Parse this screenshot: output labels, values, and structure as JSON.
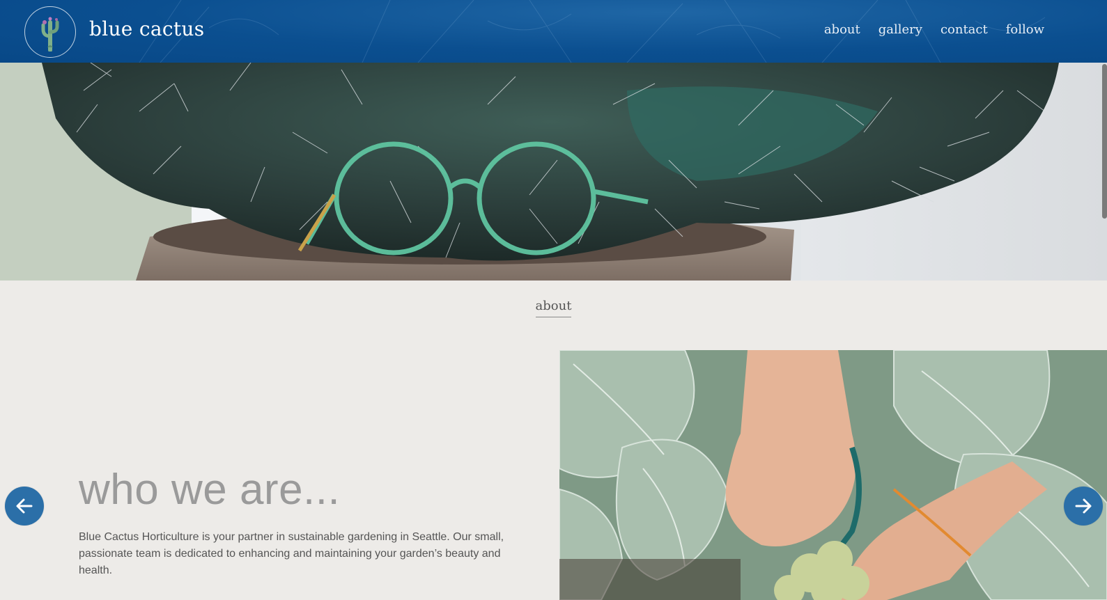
{
  "header": {
    "brand": "blue cactus",
    "nav": [
      {
        "label": "about"
      },
      {
        "label": "gallery"
      },
      {
        "label": "contact"
      },
      {
        "label": "follow"
      }
    ]
  },
  "about": {
    "section_title": "about",
    "headline": "who we are...",
    "body": "Blue Cactus Horticulture is your partner in sustainable gardening in Seattle. Our small, passionate team is dedicated to enhancing and maintaining your garden’s beauty and health."
  },
  "icons": {
    "logo": "cactus-icon",
    "prev": "arrow-left-icon",
    "next": "arrow-right-icon"
  },
  "colors": {
    "header_bg": "#0b4f90",
    "accent_button": "#2b6fa8",
    "page_bg": "#edebe8",
    "headline": "#9a9a9a"
  }
}
